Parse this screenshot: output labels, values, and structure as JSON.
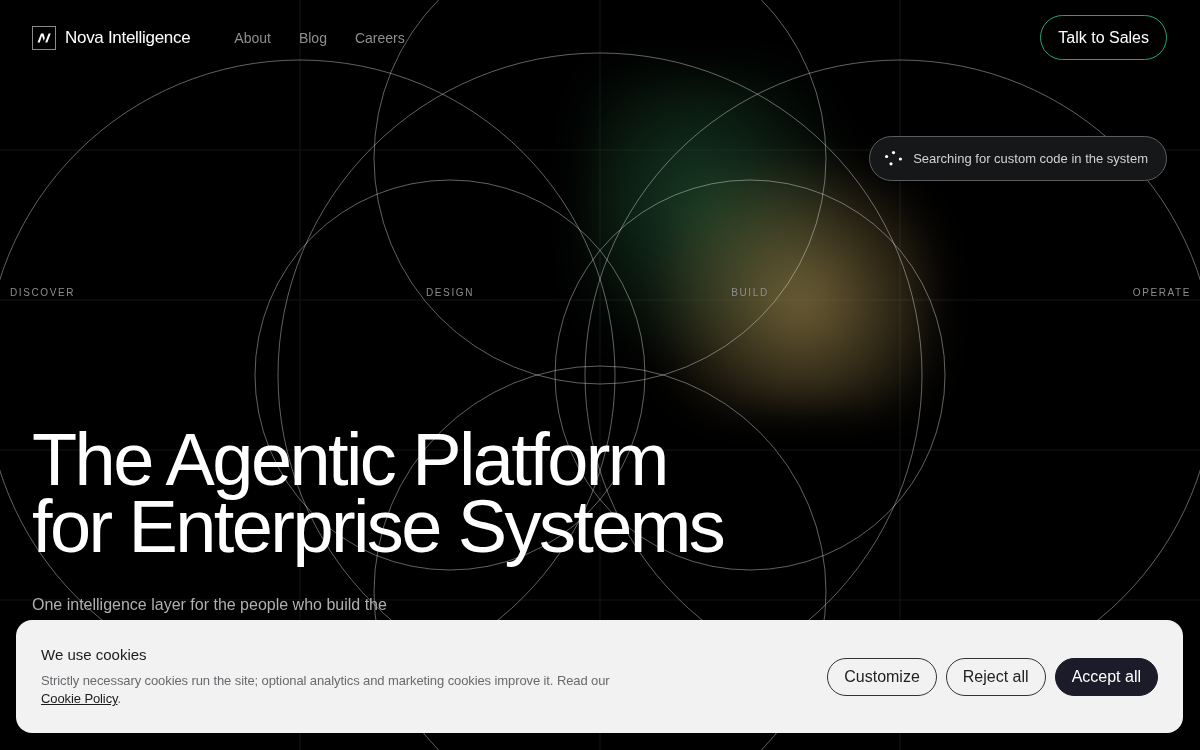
{
  "nav": {
    "brand": "Nova Intelligence",
    "links": [
      "About",
      "Blog",
      "Careers"
    ],
    "cta": "Talk to Sales"
  },
  "status_pill": {
    "text": "Searching for custom code in the system"
  },
  "stages": [
    "DISCOVER",
    "DESIGN",
    "BUILD",
    "OPERATE"
  ],
  "hero": {
    "headline_lines": [
      "The Agentic Platform",
      "for Enterprise Systems"
    ],
    "subtitle": "One intelligence layer for the people who build the"
  },
  "cookie_banner": {
    "title": "We use cookies",
    "text": "Strictly necessary cookies run the site; optional analytics and marketing cookies improve it. Read our",
    "link": "Cookie Policy",
    "text_after_link": ".",
    "buttons": [
      {
        "label": "Customize",
        "kind": "outline"
      },
      {
        "label": "Reject all",
        "kind": "outline"
      },
      {
        "label": "Accept all",
        "kind": "primary"
      }
    ]
  }
}
